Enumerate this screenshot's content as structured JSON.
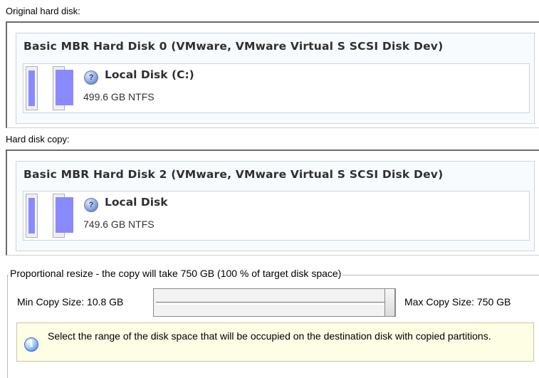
{
  "original": {
    "caption": "Original hard disk:",
    "disk_title": "Basic MBR Hard Disk 0 (VMware, VMware Virtual S SCSI Disk Dev)",
    "partition_name": "Local Disk (C:)",
    "partition_info": "499.6 GB NTFS",
    "partition_icon": "question-disk-icon"
  },
  "copy": {
    "caption": "Hard disk copy:",
    "disk_title": "Basic MBR Hard Disk 2 (VMware, VMware Virtual S SCSI Disk Dev)",
    "partition_name": "Local Disk",
    "partition_info": "749.6 GB NTFS",
    "partition_icon": "question-disk-icon"
  },
  "resize": {
    "group_label": "Proportional resize - the copy will take 750 GB (100 % of target disk space)",
    "min_label": "Min Copy Size:  10.8 GB",
    "max_label": "Max Copy Size:  750 GB",
    "slider_value_percent": 100
  },
  "info": {
    "icon": "info-icon",
    "text": "Select the range of the disk space that will be occupied on the destination disk with copied partitions."
  },
  "colors": {
    "partition_fill": "#8a8aff",
    "info_bg": "#fefee5"
  }
}
